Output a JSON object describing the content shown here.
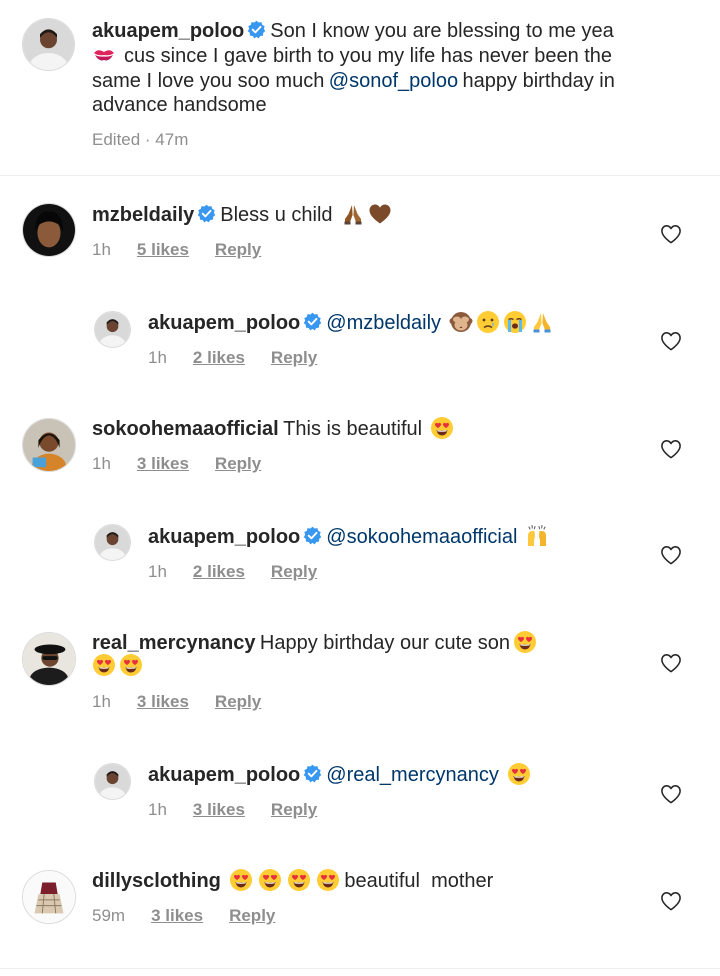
{
  "post": {
    "username": "akuapem_poloo",
    "caption_line1": "Son I know you are blessing to me yea",
    "caption_line2": "cus since I gave birth to you my life has never been the",
    "caption_line3_a": "same I love you soo much",
    "caption_mention": "@sonof_poloo",
    "caption_line3_b": "happy birthday in",
    "caption_line4": "advance handsome",
    "meta": "Edited · 47m"
  },
  "comments": [
    {
      "username": "mzbeldaily",
      "text": "Bless u child",
      "time": "1h",
      "likes": "5 likes",
      "reply": "Reply"
    },
    {
      "username": "akuapem_poloo",
      "mention": "@mzbeldaily",
      "time": "1h",
      "likes": "2 likes",
      "reply": "Reply"
    },
    {
      "username": "sokoohemaaofficial",
      "text": "This is beautiful",
      "time": "1h",
      "likes": "3 likes",
      "reply": "Reply"
    },
    {
      "username": "akuapem_poloo",
      "mention": "@sokoohemaaofficial",
      "time": "1h",
      "likes": "2 likes",
      "reply": "Reply"
    },
    {
      "username": "real_mercynancy",
      "text": "Happy birthday our cute son",
      "time": "1h",
      "likes": "3 likes",
      "reply": "Reply"
    },
    {
      "username": "akuapem_poloo",
      "mention": "@real_mercynancy",
      "time": "1h",
      "likes": "3 likes",
      "reply": "Reply"
    },
    {
      "username": "dillysclothing",
      "text": "beautiful  mother",
      "time": "59m",
      "likes": "3 likes",
      "reply": "Reply"
    }
  ],
  "colors": {
    "text": "#262626",
    "secondary": "#8e8e8e",
    "mention": "#00376b",
    "verified": "#3897f0"
  },
  "icons": [
    "verified-badge-icon",
    "heart-outline-icon",
    "kiss-mark-emoji",
    "folded-hands-emoji",
    "brown-heart-emoji",
    "see-no-evil-monkey-emoji",
    "crying-face-emoji",
    "loudly-crying-face-emoji",
    "heart-eyes-emoji",
    "raising-hands-emoji"
  ]
}
